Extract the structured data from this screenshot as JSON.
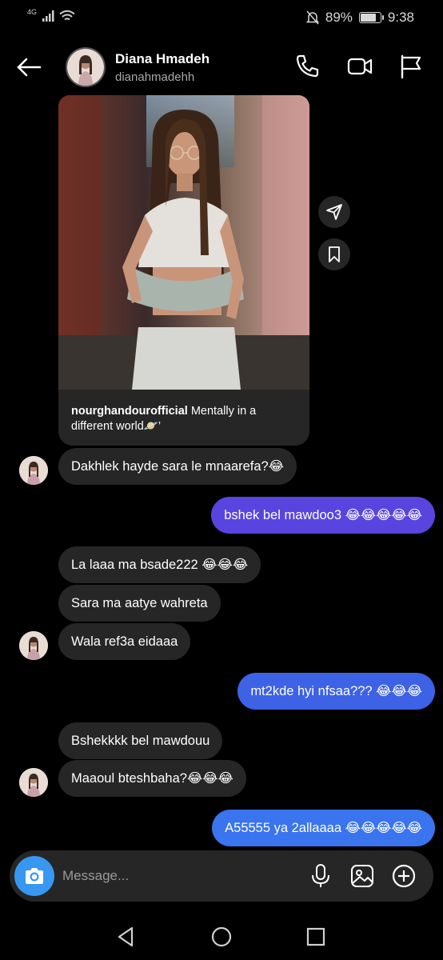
{
  "status_bar": {
    "network": "4G",
    "battery": "89%",
    "battery_level": 0.89,
    "time": "9:38"
  },
  "header": {
    "name": "Diana Hmadeh",
    "username": "dianahmadehh"
  },
  "shared_post": {
    "author": "nourghandourofficial",
    "caption": "Mentally in a different world🪐’"
  },
  "messages": [
    {
      "dir": "in",
      "text": "Dakhlek hayde sara le mnaarefa?😂"
    },
    {
      "dir": "out",
      "text": "bshek bel mawdoo3 😂😂😂😂😂"
    },
    {
      "dir": "in",
      "text": "La laaa ma bsade222 😂😂😂"
    },
    {
      "dir": "in",
      "text": "Sara ma aatye wahreta"
    },
    {
      "dir": "in",
      "text": "Wala ref3a eidaaa"
    },
    {
      "dir": "out",
      "text": "mt2kde hyi nfsaa??? 😂😂😂"
    },
    {
      "dir": "in",
      "text": "Bshekkkk bel mawdouu"
    },
    {
      "dir": "in",
      "text": "Maaoul bteshbaha?😂😂😂"
    },
    {
      "dir": "out",
      "text": "A55555 ya 2allaaaa 😂😂😂😂😂"
    }
  ],
  "composer": {
    "placeholder": "Message..."
  }
}
